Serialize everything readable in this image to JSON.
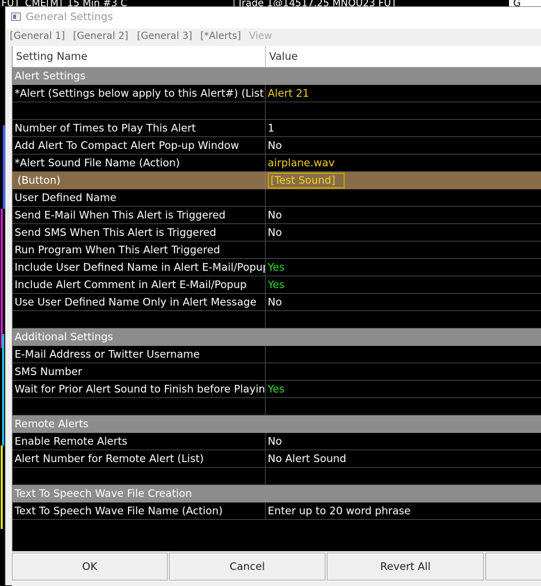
{
  "background": {
    "strip1": "FUT_CME[M]_15 Min  #3 C",
    "strip2": "Trade 1@14517.25  MNQU23 FUT",
    "strip3": "G"
  },
  "window": {
    "title": "General Settings"
  },
  "menu": [
    "[General 1]",
    "[General 2]",
    "[General 3]",
    "[*Alerts]",
    "View"
  ],
  "columns": {
    "name": "Setting Name",
    "value": "Value"
  },
  "rows": [
    {
      "kind": "section",
      "name": "Alert Settings",
      "value": ""
    },
    {
      "kind": "row",
      "name": "*Alert (Settings below apply to this Alert#) (List)",
      "value": "Alert 21",
      "color": "yellow"
    },
    {
      "kind": "blank",
      "name": "",
      "value": ""
    },
    {
      "kind": "row",
      "name": "Number of Times to Play This Alert",
      "value": "1",
      "color": "white"
    },
    {
      "kind": "row",
      "name": "Add Alert To Compact Alert Pop-up Window",
      "value": "No",
      "color": "white"
    },
    {
      "kind": "row",
      "name": "*Alert Sound File Name (Action)",
      "value": "airplane.wav",
      "color": "yellow"
    },
    {
      "kind": "button",
      "name": "(Button)",
      "value": "[Test Sound]",
      "color": "yellow"
    },
    {
      "kind": "row",
      "name": "User Defined Name",
      "value": "",
      "color": "white"
    },
    {
      "kind": "row",
      "name": "Send E-Mail When This Alert is Triggered",
      "value": "No",
      "color": "white"
    },
    {
      "kind": "row",
      "name": "Send SMS When This Alert is Triggered",
      "value": "No",
      "color": "white"
    },
    {
      "kind": "row",
      "name": "Run Program When This Alert Triggered",
      "value": "",
      "color": "white"
    },
    {
      "kind": "row",
      "name": "Include User Defined Name in Alert E-Mail/Popup",
      "value": "Yes",
      "color": "green"
    },
    {
      "kind": "row",
      "name": "Include Alert Comment in Alert E-Mail/Popup",
      "value": "Yes",
      "color": "green"
    },
    {
      "kind": "row",
      "name": "Use User Defined Name Only in Alert Message",
      "value": "No",
      "color": "white"
    },
    {
      "kind": "blank",
      "name": "",
      "value": ""
    },
    {
      "kind": "section",
      "name": "Additional Settings",
      "value": ""
    },
    {
      "kind": "row",
      "name": "E-Mail Address or Twitter Username",
      "value": "",
      "color": "white"
    },
    {
      "kind": "row",
      "name": "SMS Number",
      "value": "",
      "color": "white"
    },
    {
      "kind": "row",
      "name": "Wait for Prior Alert Sound to Finish before Playing Next",
      "value": "Yes",
      "color": "green"
    },
    {
      "kind": "blank",
      "name": "",
      "value": ""
    },
    {
      "kind": "section",
      "name": "Remote Alerts",
      "value": ""
    },
    {
      "kind": "row",
      "name": "Enable Remote Alerts",
      "value": "No",
      "color": "white"
    },
    {
      "kind": "row",
      "name": "Alert Number for Remote Alert (List)",
      "value": "No Alert Sound",
      "color": "white"
    },
    {
      "kind": "blank",
      "name": "",
      "value": ""
    },
    {
      "kind": "section",
      "name": "Text To Speech Wave File Creation",
      "value": ""
    },
    {
      "kind": "row",
      "name": "Text To Speech Wave File Name (Action)",
      "value": "Enter up to 20 word phrase",
      "color": "white"
    }
  ],
  "buttons": {
    "ok": "OK",
    "cancel": "Cancel",
    "revert": "Revert All"
  }
}
